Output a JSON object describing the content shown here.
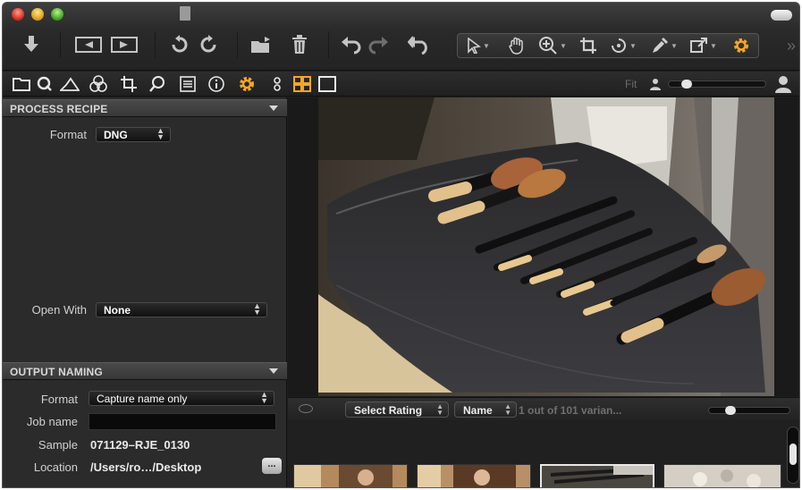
{
  "toolbar": {
    "cursor_tools": [
      "select-cursor",
      "hand-pan",
      "zoom",
      "crop",
      "rotate",
      "color-picker",
      "copy-apply",
      "settings"
    ]
  },
  "tooltabs": {
    "fit_label": "Fit",
    "active_tab": "process"
  },
  "process_recipe": {
    "title": "PROCESS RECIPE",
    "format_label": "Format",
    "format_value": "DNG",
    "open_with_label": "Open With",
    "open_with_value": "None"
  },
  "output_naming": {
    "title": "OUTPUT NAMING",
    "format_label": "Format",
    "format_value": "Capture name only",
    "job_name_label": "Job name",
    "job_name_value": "",
    "sample_label": "Sample",
    "sample_value": "071129–RJE_0130",
    "location_label": "Location",
    "location_value": "/Users/ro…/Desktop",
    "location_button": "..."
  },
  "filter": {
    "rating_label": "Select Rating",
    "sort_label": "Name",
    "variant_count": "1 out of 101 varian..."
  },
  "colors": {
    "accent_orange": "#f5a623",
    "panel_bg": "#2b2b2b",
    "header_bg": "#3d3d3d"
  }
}
